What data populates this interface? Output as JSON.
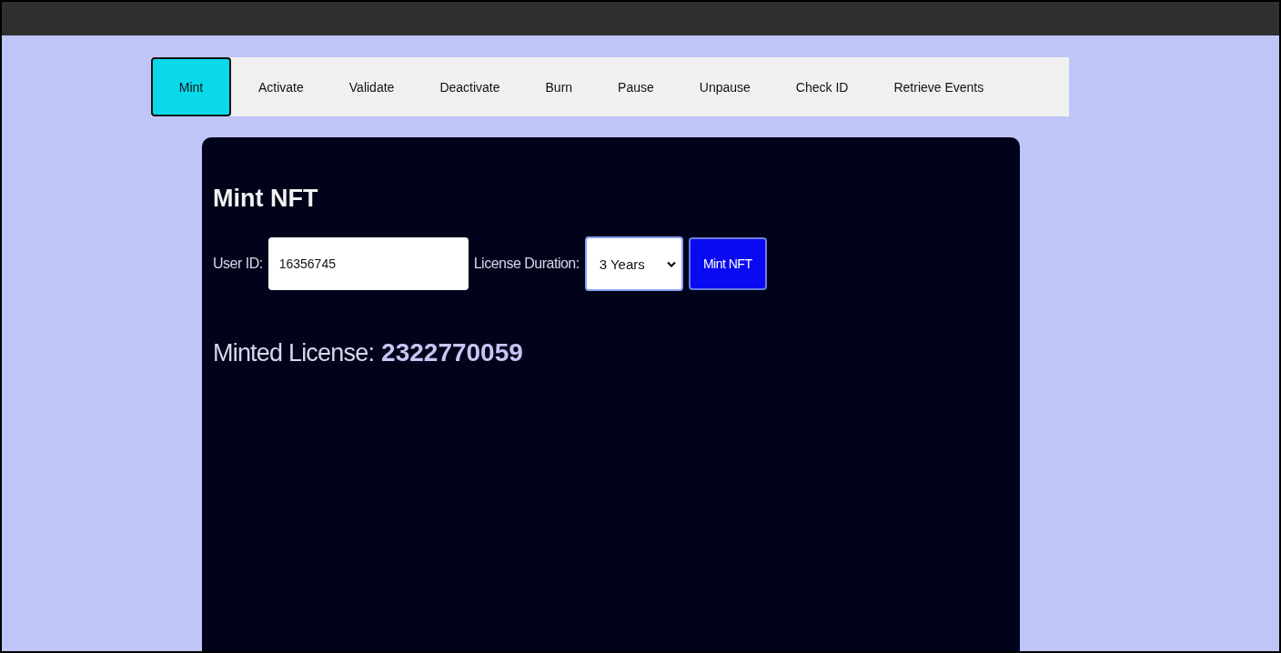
{
  "tabs": [
    {
      "label": "Mint",
      "selected": true
    },
    {
      "label": "Activate",
      "selected": false
    },
    {
      "label": "Validate",
      "selected": false
    },
    {
      "label": "Deactivate",
      "selected": false
    },
    {
      "label": "Burn",
      "selected": false
    },
    {
      "label": "Pause",
      "selected": false
    },
    {
      "label": "Unpause",
      "selected": false
    },
    {
      "label": "Check ID",
      "selected": false
    },
    {
      "label": "Retrieve Events",
      "selected": false
    }
  ],
  "panel": {
    "title": "Mint NFT",
    "user_id": {
      "label": "User ID:",
      "value": "16356745"
    },
    "duration": {
      "label": "License Duration:",
      "value": "3 Years"
    },
    "submit": "Mint NFT",
    "result": {
      "label": "Minted License:",
      "value": "2322770059"
    }
  }
}
